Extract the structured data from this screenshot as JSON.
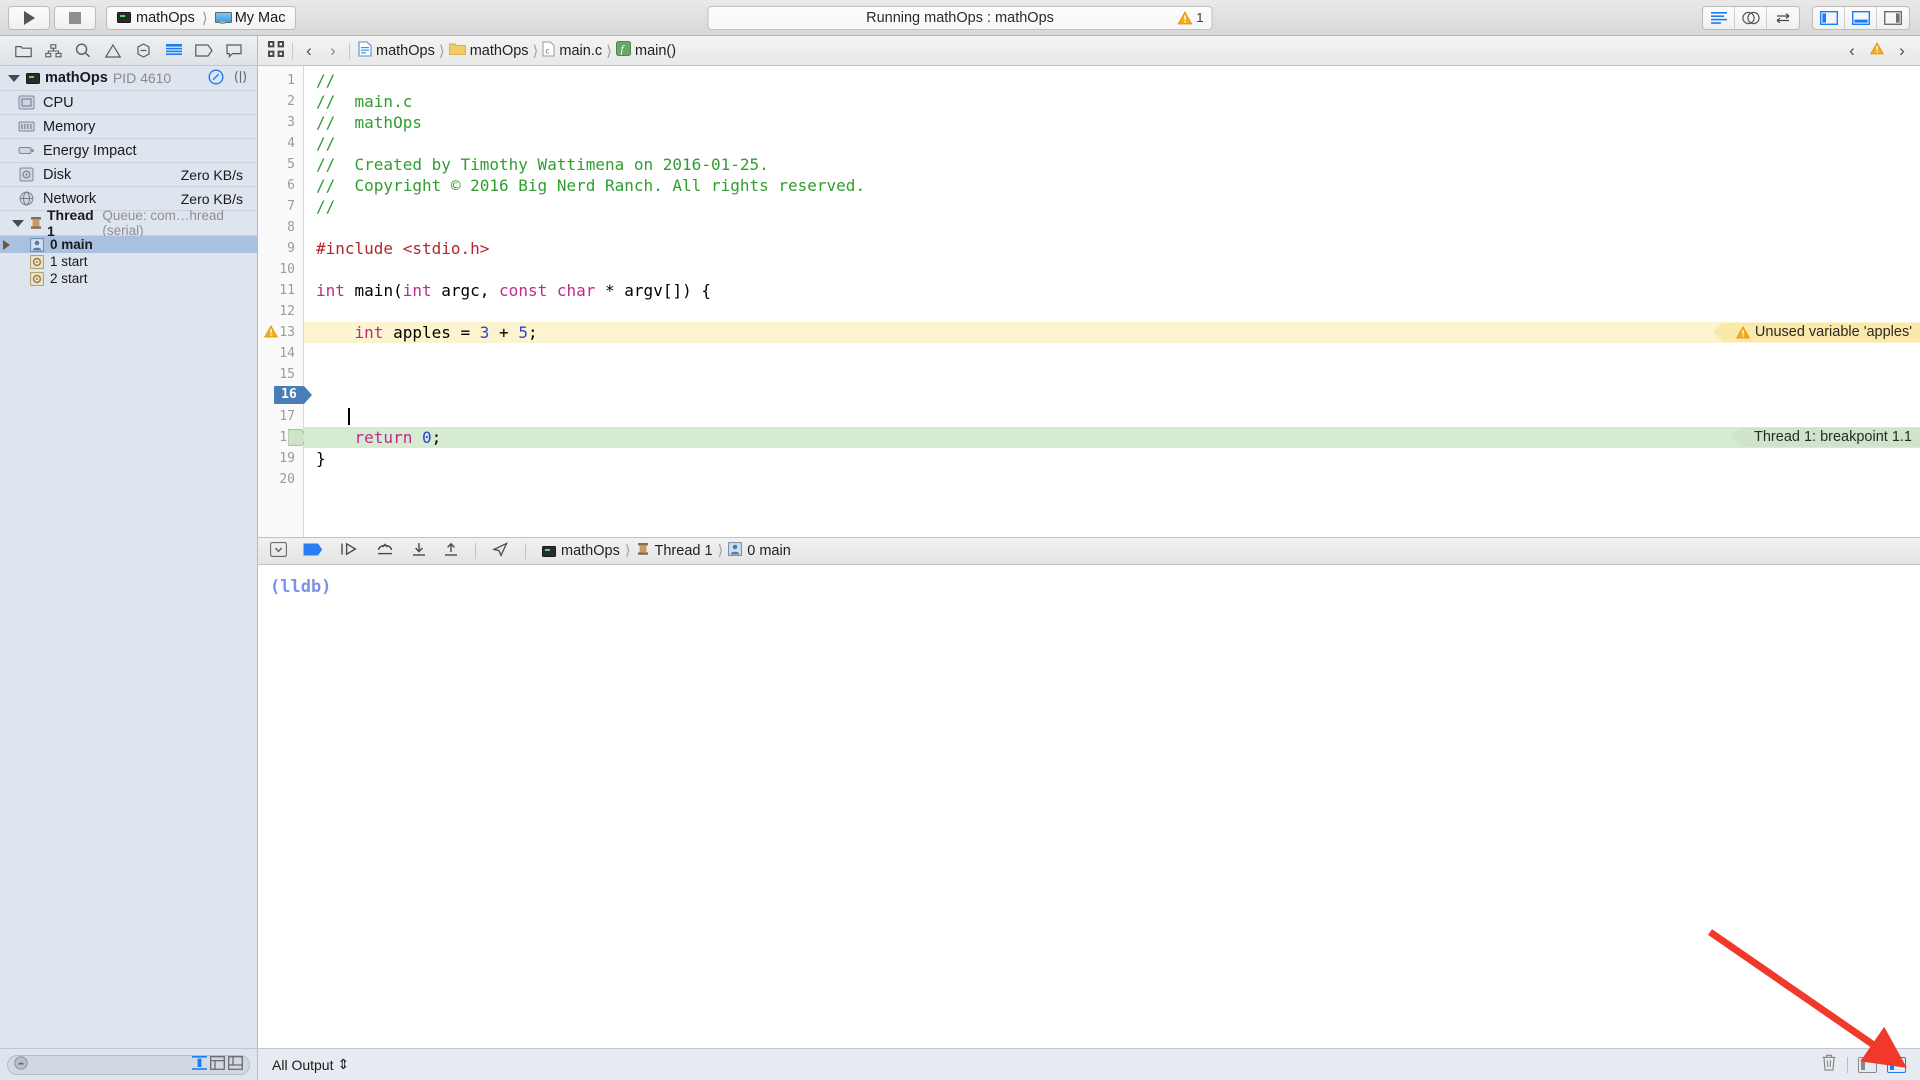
{
  "toolbar": {
    "run_label": "run-button",
    "stop_label": "stop-button",
    "scheme_target": "mathOps",
    "scheme_destination": "My Mac",
    "status_text": "Running mathOps : mathOps",
    "warning_count": "1"
  },
  "navigator": {
    "process": {
      "name": "mathOps",
      "pid": "PID 4610"
    },
    "gauges": [
      {
        "label": "CPU",
        "value": ""
      },
      {
        "label": "Memory",
        "value": ""
      },
      {
        "label": "Energy Impact",
        "value": ""
      },
      {
        "label": "Disk",
        "value": "Zero KB/s"
      },
      {
        "label": "Network",
        "value": "Zero KB/s"
      }
    ],
    "thread": {
      "name": "Thread 1",
      "queue": "Queue: com…hread (serial)"
    },
    "frames": [
      {
        "label": "0 main",
        "selected": true
      },
      {
        "label": "1 start",
        "selected": false
      },
      {
        "label": "2 start",
        "selected": false
      }
    ],
    "filter_placeholder": ""
  },
  "jumpbar": {
    "crumbs": [
      "mathOps",
      "mathOps",
      "main.c",
      "main()"
    ]
  },
  "editor": {
    "filename": "main.c",
    "lines": [
      {
        "n": "1",
        "html": "<span class='c-comment'>//</span>"
      },
      {
        "n": "2",
        "html": "<span class='c-comment'>//  main.c</span>"
      },
      {
        "n": "3",
        "html": "<span class='c-comment'>//  mathOps</span>"
      },
      {
        "n": "4",
        "html": "<span class='c-comment'>//</span>"
      },
      {
        "n": "5",
        "html": "<span class='c-comment'>//  Created by Timothy Wattimena on 2016-01-25.</span>"
      },
      {
        "n": "6",
        "html": "<span class='c-comment'>//  Copyright © 2016 Big Nerd Ranch. All rights reserved.</span>"
      },
      {
        "n": "7",
        "html": "<span class='c-comment'>//</span>"
      },
      {
        "n": "8",
        "html": ""
      },
      {
        "n": "9",
        "html": "<span class='c-pre'>#include &lt;stdio.h&gt;</span>"
      },
      {
        "n": "10",
        "html": ""
      },
      {
        "n": "11",
        "html": "<span class='c-kw'>int</span> main(<span class='c-kw'>int</span> argc, <span class='c-kw'>const</span> <span class='c-kw'>char</span> * argv[]) {"
      },
      {
        "n": "12",
        "html": ""
      },
      {
        "n": "13",
        "html": "    <span class='c-kw'>int</span> apples = <span class='c-num'>3</span> + <span class='c-num'>5</span>;",
        "highlight": "warn"
      },
      {
        "n": "14",
        "html": ""
      },
      {
        "n": "15",
        "html": ""
      },
      {
        "n": "16",
        "html": "",
        "current": true
      },
      {
        "n": "17",
        "html": ""
      },
      {
        "n": "18",
        "html": "    <span class='c-kw'>return</span> <span class='c-num'>0</span>;",
        "highlight": "bp"
      },
      {
        "n": "19",
        "html": "}"
      },
      {
        "n": "20",
        "html": ""
      }
    ],
    "annotations": {
      "warning": "Unused variable 'apples'",
      "breakpoint": "Thread 1: breakpoint 1.1"
    }
  },
  "debugbar": {
    "crumbs": [
      "mathOps",
      "Thread 1",
      "0 main"
    ]
  },
  "console": {
    "prompt": "(lldb)"
  },
  "bottombar": {
    "output_filter": "All Output",
    "output_filter_arrows": "⇕"
  },
  "colors": {
    "accent_blue": "#1a7df5",
    "warning_yellow": "#f5ab1c",
    "comment_green": "#2f9e2f",
    "keyword_magenta": "#c02a8a",
    "number_blue": "#2a44d6",
    "string_red": "#b3272d",
    "selection_blue": "#a9c0de",
    "current_line_blue": "#4a7db5",
    "warn_row_bg": "#fcf4ce",
    "bp_row_bg": "#d6ebd2",
    "arrow_red": "#f0392b"
  }
}
